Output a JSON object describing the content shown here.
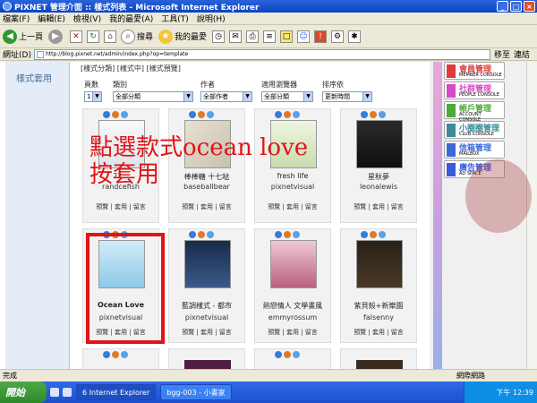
{
  "window": {
    "title": "PIXNET 管理介面 :: 樣式列表 - Microsoft Internet Explorer"
  },
  "menu": [
    "檔案(F)",
    "編輯(E)",
    "檢視(V)",
    "我的最愛(A)",
    "工具(T)",
    "說明(H)"
  ],
  "toolbar": {
    "back": "上一頁",
    "search": "搜尋",
    "favorites": "我的最愛"
  },
  "address": {
    "url": "http://blog.pixnet.net/admin/index.php?op=template",
    "go": "移至",
    "links": "連結"
  },
  "left": {
    "label": "樣式套用"
  },
  "tabs": "[樣式分類] [樣式中] [樣式預覽]",
  "filters": {
    "page": {
      "label": "頁數",
      "value": "1"
    },
    "category": {
      "label": "類別",
      "value": "全部分類"
    },
    "author": {
      "label": "作者",
      "value": "全部作者"
    },
    "browser": {
      "label": "適用瀏覽器",
      "value": "全部分類"
    },
    "sort": {
      "label": "排序依",
      "value": "更新時間"
    }
  },
  "cards": [
    {
      "name": "22...",
      "author": "randcefish",
      "actions": "預覽 | 套用 | 留言"
    },
    {
      "name": "棒棒糖 十七哒",
      "author": "baseballbear",
      "actions": "預覽 | 套用 | 留言"
    },
    {
      "name": "fresh life",
      "author": "pixnetvisual",
      "actions": "預覽 | 套用 | 留言"
    },
    {
      "name": "星秋夢",
      "author": "leonalewis",
      "actions": "預覽 | 套用 | 留言"
    },
    {
      "name": "Ocean Love",
      "author": "pixnetvisual",
      "actions": "預覽 | 套用 | 留言"
    },
    {
      "name": "藍調樣式 - 都市",
      "author": "pixnetvisual",
      "actions": "預覽 | 套用 | 留言"
    },
    {
      "name": "熱戀情人 文學畫風",
      "author": "emmyrossum",
      "actions": "預覽 | 套用 | 留言"
    },
    {
      "name": "紫貝殼+新樂園",
      "author": "falsenny",
      "actions": "預覽 | 套用 | 留言"
    }
  ],
  "overlay": {
    "line1": "點選款式ocean love",
    "line2": "按套用"
  },
  "right_menu": [
    {
      "title": "會員管理",
      "sub": "MEMBER CONSOLE",
      "color": "#e03a3a"
    },
    {
      "title": "社群管理",
      "sub": "PEOPLE CONSOLE",
      "color": "#d848c8"
    },
    {
      "title": "帳戶管理",
      "sub": "ACCOUNT CONSOLE",
      "color": "#4caa3a"
    },
    {
      "title": "小圈圈管理",
      "sub": "CLUB CONSOLE",
      "color": "#3a8a9a"
    },
    {
      "title": "信箱管理",
      "sub": "MAILBOX",
      "color": "#3a6ad8"
    },
    {
      "title": "廣告管理",
      "sub": "AD SPACE",
      "color": "#3a5ad8"
    }
  ],
  "status": {
    "text": "完成",
    "zone": "網際網路"
  },
  "taskbar": {
    "start": "開始",
    "tasks": [
      "6 Internet Explorer",
      "bgg-003 - 小畫家"
    ],
    "clock": "下午 12:39"
  }
}
